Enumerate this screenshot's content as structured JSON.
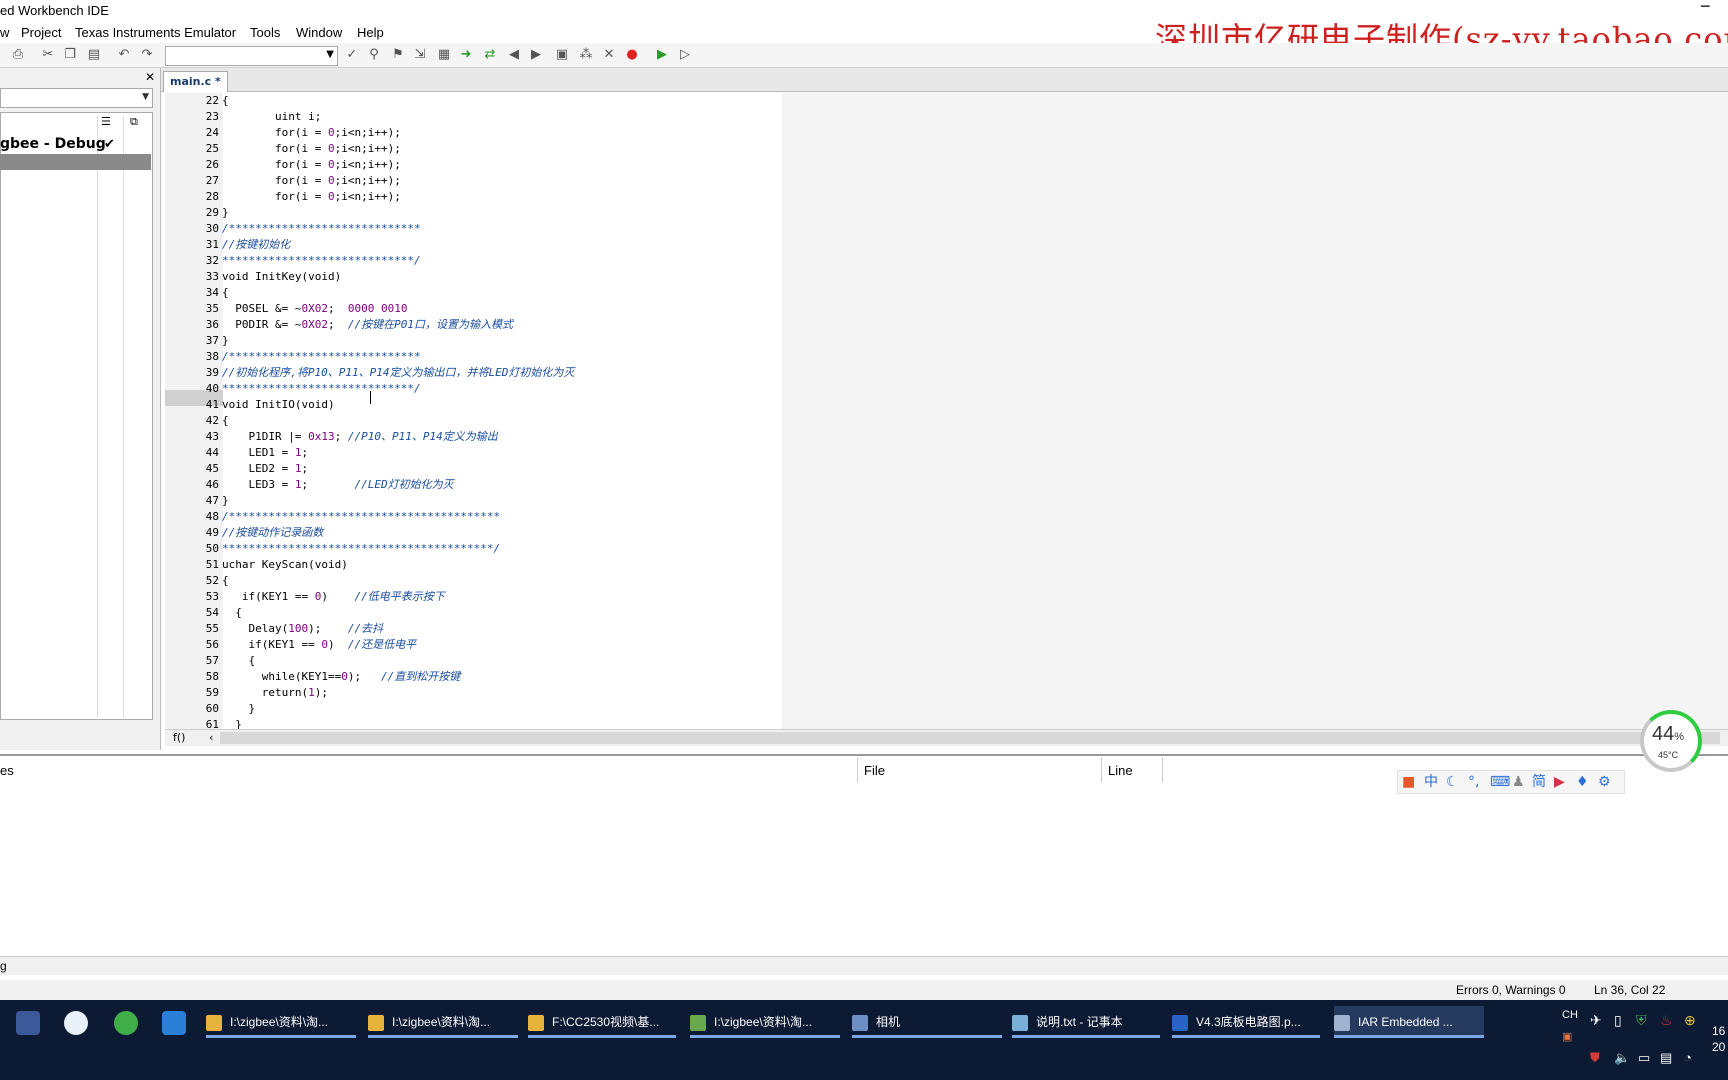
{
  "title": "ed Workbench IDE",
  "menu": [
    "w",
    "Project",
    "Texas Instruments Emulator",
    "Tools",
    "Window",
    "Help"
  ],
  "watermark": "深圳市亿研电子制作(sz-yy.taobao.com)",
  "toolbar_icons": [
    "print-icon",
    "cut-icon",
    "copy-icon",
    "paste-icon",
    "undo-icon",
    "redo-icon",
    "toggle-breakpoint-icon",
    "debug-icon",
    "make-icon",
    "stop-icon",
    "download-icon"
  ],
  "project": {
    "name": "gbee - Debug",
    "check": "✔"
  },
  "tab": {
    "label": "main.c *"
  },
  "code": [
    {
      "n": "22",
      "h": "{"
    },
    {
      "n": "23",
      "h": "        uint i;"
    },
    {
      "n": "24",
      "h": "        for(i = <span class=\"num\">0</span>;i&lt;n;i++);"
    },
    {
      "n": "25",
      "h": "        for(i = <span class=\"num\">0</span>;i&lt;n;i++);"
    },
    {
      "n": "26",
      "h": "        for(i = <span class=\"num\">0</span>;i&lt;n;i++);"
    },
    {
      "n": "27",
      "h": "        for(i = <span class=\"num\">0</span>;i&lt;n;i++);"
    },
    {
      "n": "28",
      "h": "        for(i = <span class=\"num\">0</span>;i&lt;n;i++);"
    },
    {
      "n": "29",
      "h": "}"
    },
    {
      "n": "30",
      "h": "<span class=\"cm\">/*****************************</span>"
    },
    {
      "n": "31",
      "h": "<span class=\"cm\">//按键初始化</span>"
    },
    {
      "n": "32",
      "h": "<span class=\"cm\">*****************************/</span>"
    },
    {
      "n": "33",
      "h": "void InitKey(void)"
    },
    {
      "n": "34",
      "h": "{"
    },
    {
      "n": "35",
      "h": "  P0SEL &amp;= ~<span class=\"num\">0X02</span>;  <span class=\"num\">0000 0010</span>"
    },
    {
      "n": "36",
      "h": "  P0DIR &amp;= ~<span class=\"num\">0X02</span>;  <span class=\"cm\">//按键在P01口，设置为输入模式</span>"
    },
    {
      "n": "37",
      "h": "}"
    },
    {
      "n": "38",
      "h": "<span class=\"cm\">/*****************************</span>"
    },
    {
      "n": "39",
      "h": "<span class=\"cm\">//初始化程序,将P10、P11、P14定义为输出口，并将LED灯初始化为灭</span>"
    },
    {
      "n": "40",
      "h": "<span class=\"cm\">*****************************/</span>"
    },
    {
      "n": "41",
      "h": "void InitIO(void)"
    },
    {
      "n": "42",
      "h": "{"
    },
    {
      "n": "43",
      "h": "    P1DIR |= <span class=\"num\">0x13</span>; <span class=\"cm\">//P10、P11、P14定义为输出</span>"
    },
    {
      "n": "44",
      "h": "    LED1 = <span class=\"num\">1</span>;"
    },
    {
      "n": "45",
      "h": "    LED2 = <span class=\"num\">1</span>;"
    },
    {
      "n": "46",
      "h": "    LED3 = <span class=\"num\">1</span>;       <span class=\"cm\">//LED灯初始化为灭</span>"
    },
    {
      "n": "47",
      "h": "}"
    },
    {
      "n": "48",
      "h": "<span class=\"cm\">/*****************************************</span>"
    },
    {
      "n": "49",
      "h": "<span class=\"cm\">//按键动作记录函数</span>"
    },
    {
      "n": "50",
      "h": "<span class=\"cm\">*****************************************/</span>"
    },
    {
      "n": "51",
      "h": "uchar KeyScan(void)"
    },
    {
      "n": "52",
      "h": "{"
    },
    {
      "n": "53",
      "h": "   if(KEY1 == <span class=\"num\">0</span>)    <span class=\"cm\">//低电平表示按下</span>"
    },
    {
      "n": "54",
      "h": "  {"
    },
    {
      "n": "55",
      "h": "    Delay(<span class=\"num\">100</span>);    <span class=\"cm\">//去抖</span>"
    },
    {
      "n": "56",
      "h": "    if(KEY1 == <span class=\"num\">0</span>)  <span class=\"cm\">//还是低电平</span>"
    },
    {
      "n": "57",
      "h": "    {"
    },
    {
      "n": "58",
      "h": "      while(KEY1==<span class=\"num\">0</span>);   <span class=\"cm\">//直到松开按键</span>"
    },
    {
      "n": "59",
      "h": "      return(<span class=\"num\">1</span>);"
    },
    {
      "n": "60",
      "h": "    }"
    },
    {
      "n": "61",
      "h": "  }"
    }
  ],
  "messages": {
    "col1": "es",
    "col2": "File",
    "col3": "Line"
  },
  "ime": [
    "中",
    "简"
  ],
  "gauge": {
    "percent": "44",
    "unit": "%",
    "temp": "45°C"
  },
  "buildbar": "g",
  "status": {
    "errors": "Errors 0, Warnings 0",
    "pos": "Ln 36, Col 22"
  },
  "taskbar": [
    {
      "label": "I:\\zigbee\\资料\\淘...",
      "color": "#e8b33c"
    },
    {
      "label": "I:\\zigbee\\资料\\淘...",
      "color": "#e8b33c"
    },
    {
      "label": "F:\\CC2530视频\\基...",
      "color": "#e8b33c"
    },
    {
      "label": "I:\\zigbee\\资料\\淘...",
      "color": "#6aa84f"
    },
    {
      "label": "相机",
      "color": "#6d8fc5"
    },
    {
      "label": "说明.txt - 记事本",
      "color": "#7ab0d8"
    },
    {
      "label": "V4.3底板电路图.p...",
      "color": "#2a63c8"
    },
    {
      "label": "IAR Embedded ...",
      "color": "#9fb3d0"
    }
  ],
  "tray": {
    "lang": "CH",
    "time": "16",
    "date": "20"
  }
}
